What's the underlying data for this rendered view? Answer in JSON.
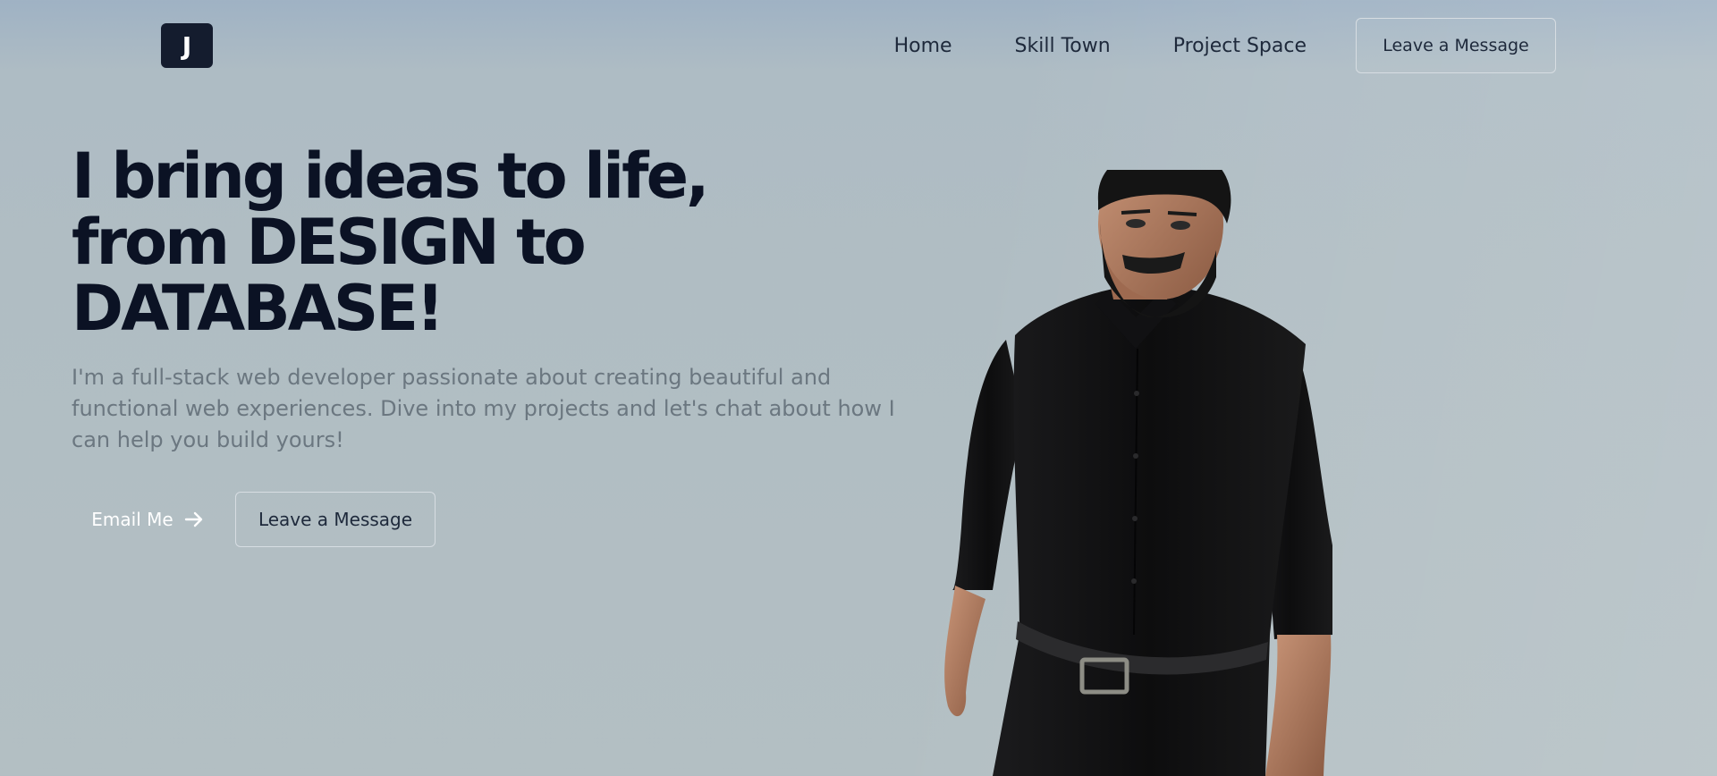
{
  "logo": {
    "letter": "J"
  },
  "nav": {
    "links": [
      "Home",
      "Skill Town",
      "Project Space"
    ],
    "cta": "Leave a Message"
  },
  "hero": {
    "title_line1": "I bring ideas to life,",
    "title_line2": "from DESIGN to",
    "title_line3": "DATABASE!",
    "subtitle": "I'm a full-stack web developer passionate about creating beautiful and functional web experiences. Dive into my projects and let's chat about how I can help you build yours!",
    "email_button": "Email Me",
    "message_button": "Leave a Message"
  },
  "colors": {
    "background": "#aebcc4",
    "title": "#0b1224",
    "logo_bg": "#141c2e",
    "subtitle": "#6b7780"
  },
  "icons": {
    "email_arrow": "arrow-right-icon",
    "avatar": "3d-avatar-character"
  }
}
